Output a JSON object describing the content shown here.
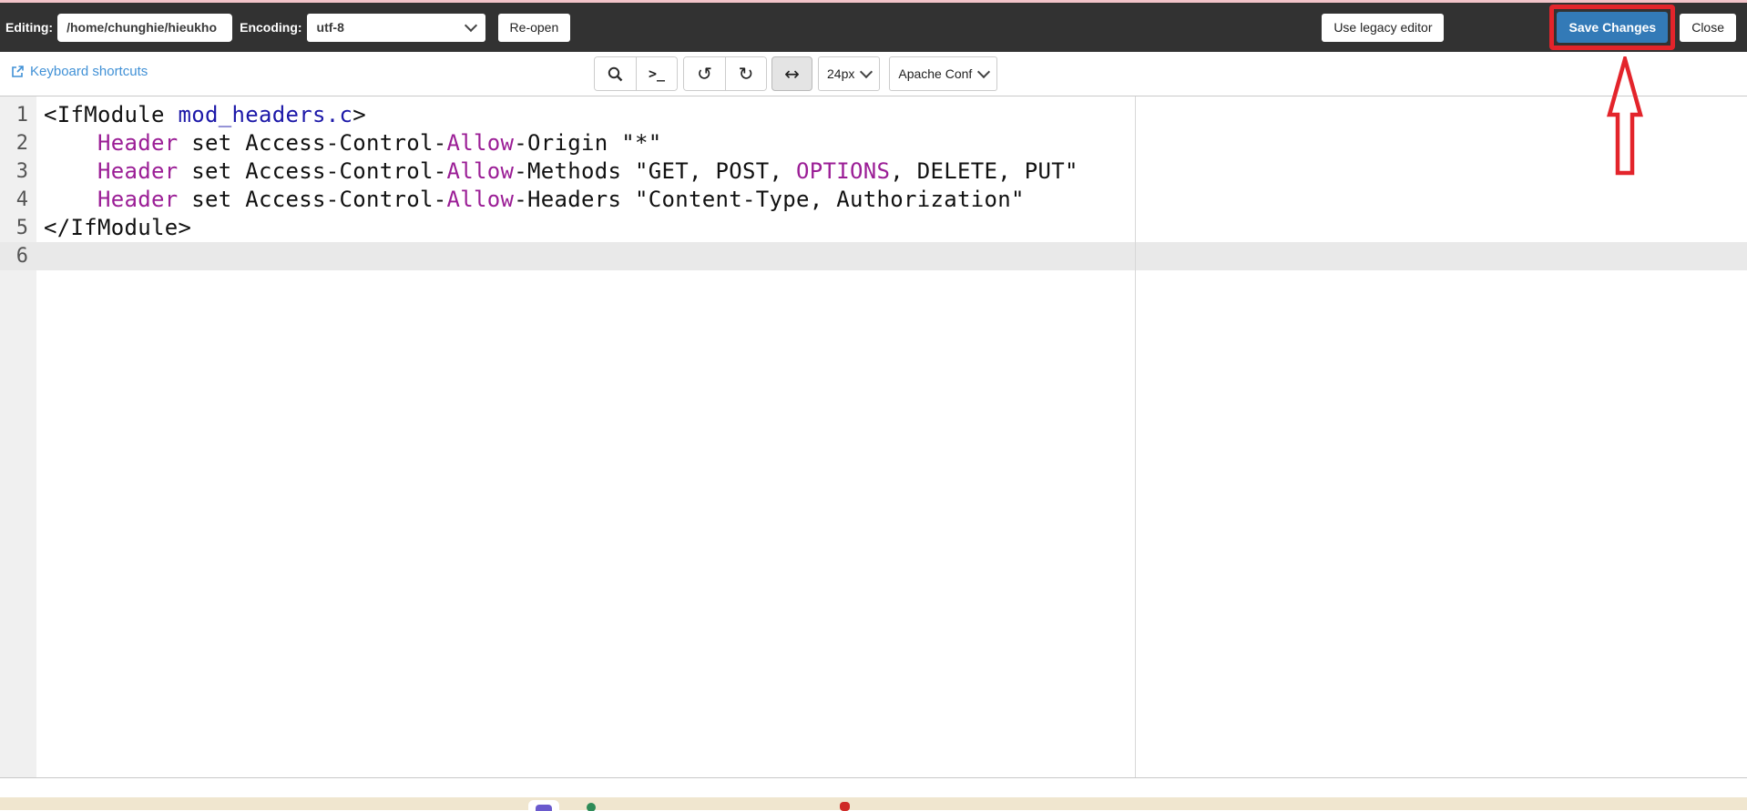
{
  "topbar": {
    "editing_label": "Editing:",
    "path_value": "/home/chunghie/hieukho",
    "encoding_label": "Encoding:",
    "encoding_value": "utf-8",
    "reopen_label": "Re-open",
    "legacy_button_label": "Use legacy editor",
    "save_button_label": "Save Changes",
    "close_button_label": "Close"
  },
  "toolbar": {
    "keyboard_shortcuts_label": "Keyboard shortcuts",
    "terminal_glyph": ">_",
    "undo_glyph": "↺",
    "redo_glyph": "↻",
    "horizontal_arrow_glyph": "↔",
    "font_size_value": "24px",
    "syntax_mode_value": "Apache Conf"
  },
  "editor": {
    "active_line": 6,
    "lines": [
      {
        "num": 1,
        "segments": [
          {
            "text": "<IfModule ",
            "cls": "plain"
          },
          {
            "text": "mod_headers.c",
            "cls": "atom"
          },
          {
            "text": ">",
            "cls": "plain"
          }
        ]
      },
      {
        "num": 2,
        "segments": [
          {
            "text": "    ",
            "cls": "plain"
          },
          {
            "text": "Header",
            "cls": "keyword"
          },
          {
            "text": " set Access-Control-",
            "cls": "plain"
          },
          {
            "text": "Allow",
            "cls": "keyword"
          },
          {
            "text": "-Origin \"*\"",
            "cls": "plain"
          }
        ]
      },
      {
        "num": 3,
        "segments": [
          {
            "text": "    ",
            "cls": "plain"
          },
          {
            "text": "Header",
            "cls": "keyword"
          },
          {
            "text": " set Access-Control-",
            "cls": "plain"
          },
          {
            "text": "Allow",
            "cls": "keyword"
          },
          {
            "text": "-Methods \"GET, POST, ",
            "cls": "plain"
          },
          {
            "text": "OPTIONS",
            "cls": "keyword"
          },
          {
            "text": ", DELETE, PUT\"",
            "cls": "plain"
          }
        ]
      },
      {
        "num": 4,
        "segments": [
          {
            "text": "    ",
            "cls": "plain"
          },
          {
            "text": "Header",
            "cls": "keyword"
          },
          {
            "text": " set Access-Control-",
            "cls": "plain"
          },
          {
            "text": "Allow",
            "cls": "keyword"
          },
          {
            "text": "-Headers \"Content-Type, Authorization\"",
            "cls": "plain"
          }
        ]
      },
      {
        "num": 5,
        "segments": [
          {
            "text": "</IfModule>",
            "cls": "plain"
          }
        ]
      },
      {
        "num": 6,
        "segments": []
      }
    ]
  },
  "annotations": {
    "highlight_box_target": "save-button",
    "arrow_direction": "up"
  },
  "colors": {
    "topbar_bg": "#323232",
    "accent_pink": "#f2c4c9",
    "save_button_blue": "#337ab7",
    "annotation_red": "#e3242b",
    "link_blue": "#4191d6",
    "keyword_purple": "#9b1e96",
    "atom_blue": "#1c18a8",
    "active_line_bg": "#e9e9e9",
    "gutter_bg": "#f0f0f0",
    "taskbar_strip_tan": "#f0e6cf"
  }
}
